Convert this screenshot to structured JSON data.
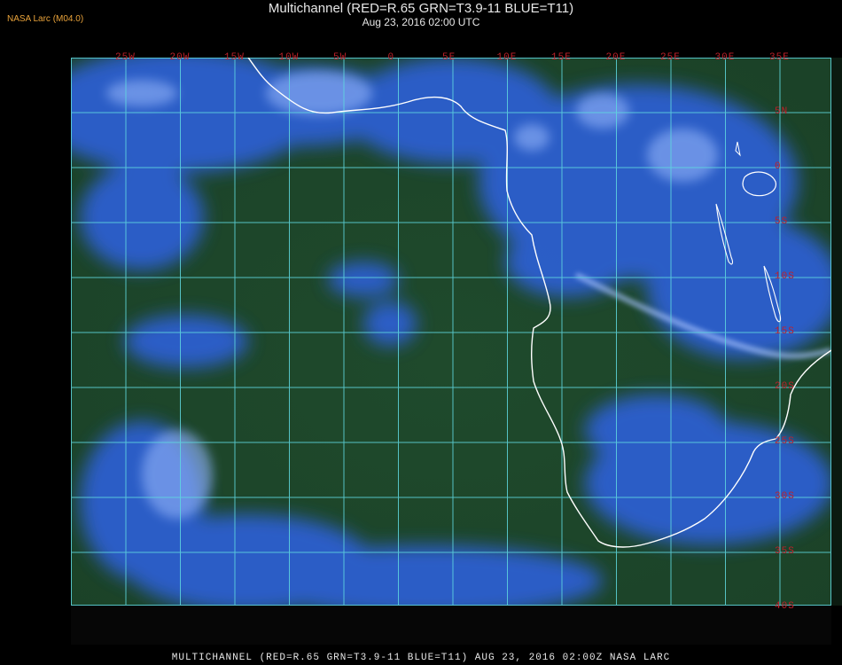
{
  "header": {
    "brand": "NASA Larc (M04.0)",
    "title": "Multichannel (RED=R.65 GRN=T3.9-11 BLUE=T11)",
    "subtitle": "Aug 23, 2016 02:00 UTC"
  },
  "map": {
    "longitude_labels": [
      "25W",
      "20W",
      "15W",
      "10W",
      "5W",
      "0",
      "5E",
      "10E",
      "15E",
      "20E",
      "25E",
      "30E",
      "35E"
    ],
    "latitude_labels": [
      "5N",
      "0",
      "5S",
      "10S",
      "15S",
      "20S",
      "25S",
      "30S",
      "35S",
      "40S"
    ],
    "colors": {
      "ocean": "#1e4b2a",
      "cloud": "#2f63e6",
      "bright_cloud": "#9fc0ff",
      "grid": "#5fd8e0",
      "coast": "#ffffff",
      "label": "#c0202a"
    }
  },
  "footer": {
    "caption": "MULTICHANNEL (RED=R.65 GRN=T3.9-11 BLUE=T11) AUG 23, 2016 02:00Z   NASA LARC"
  }
}
